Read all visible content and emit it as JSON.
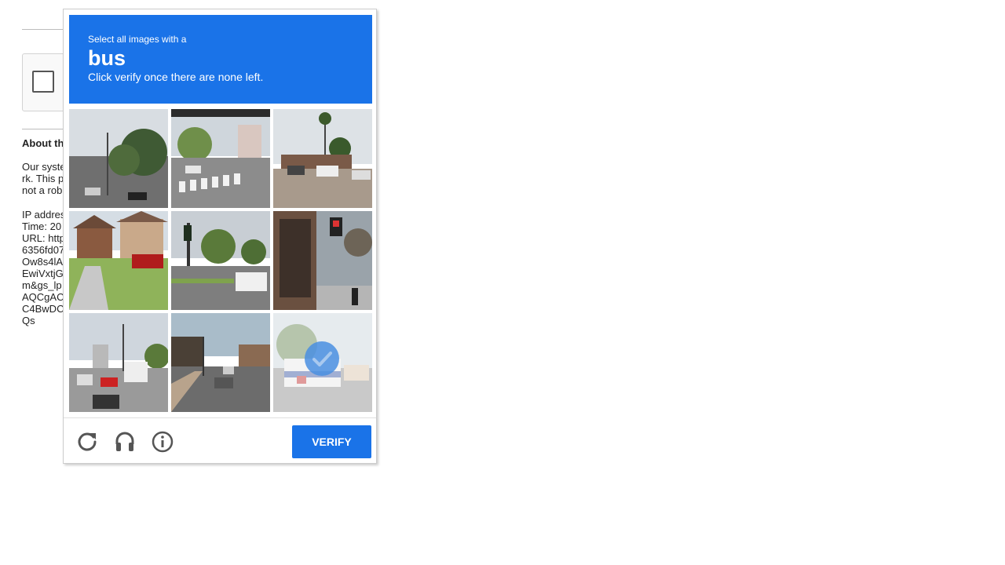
{
  "background": {
    "heading": "About th",
    "paragraph_lines": [
      "Our syste",
      "rk. This p",
      "not a rob"
    ],
    "meta_lines": [
      "IP addres",
      "Time: 20",
      "URL: http",
      "6356fd07",
      "Ow8s4lA",
      "EwiVxtjG",
      "m&gs_lp",
      "AQCgAC",
      "C4BwDC",
      "Qs"
    ]
  },
  "challenge": {
    "instruction_line1": "Select all images with a",
    "keyword": "bus",
    "instruction_line3": "Click verify once there are none left.",
    "tiles": [
      {
        "scene": "street-trees-cars",
        "selected": false
      },
      {
        "scene": "crosswalk-intersection",
        "selected": false
      },
      {
        "scene": "parking-lot-palm",
        "selected": false
      },
      {
        "scene": "suburban-houses",
        "selected": false
      },
      {
        "scene": "traffic-light-intersection",
        "selected": false
      },
      {
        "scene": "sidewalk-storefront",
        "selected": false
      },
      {
        "scene": "busy-street-traffic",
        "selected": false
      },
      {
        "scene": "road-with-cars",
        "selected": false
      },
      {
        "scene": "bus-on-street",
        "selected": true
      }
    ],
    "footer": {
      "reload_icon": "reload-icon",
      "audio_icon": "headphones-icon",
      "info_icon": "info-icon",
      "verify_label": "VERIFY"
    },
    "colors": {
      "header_bg": "#1a73e8",
      "button_bg": "#1a73e8",
      "check_badge": "#4a90e2"
    }
  }
}
